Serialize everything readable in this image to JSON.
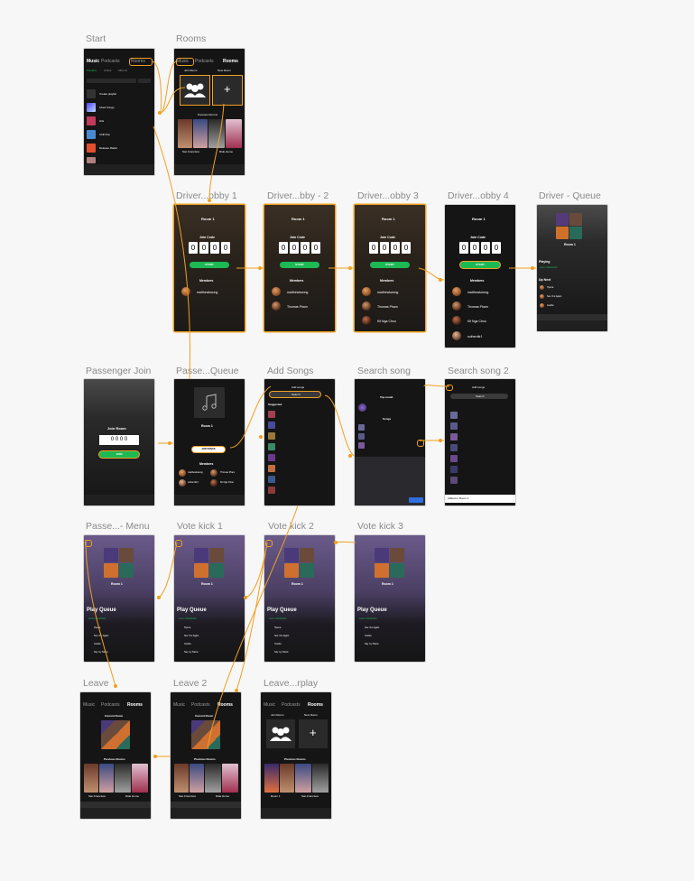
{
  "labels": {
    "start": "Start",
    "rooms": "Rooms",
    "driver_lobby_1": "Driver...obby 1",
    "driver_lobby_2": "Driver...bby - 2",
    "driver_lobby_3": "Driver...obby 3",
    "driver_lobby_4": "Driver...obby 4",
    "driver_queue": "Driver - Queue",
    "passenger_join": "Passenger Join",
    "passenger_queue": "Passe...Queue",
    "add_songs": "Add Songs",
    "search_song": "Search song",
    "search_song_2": "Search song 2",
    "passenger_menu": "Passe...- Menu",
    "vote_kick_1": "Vote kick 1",
    "vote_kick_2": "Vote kick 2",
    "vote_kick_3": "Vote kick 3",
    "leave": "Leave",
    "leave_2": "Leave 2",
    "leave_replay": "Leave...rplay"
  },
  "screens": {
    "top_tabs": {
      "music": "Music",
      "podcasts": "Podcasts",
      "rooms": "Rooms"
    },
    "lib_filters": {
      "playlists": "Playlists",
      "artists": "Artists",
      "albums": "Albums"
    },
    "lib_items": [
      "Create playlist",
      "Liked Songs",
      "Hits",
      "Chill Pop",
      "Release Radar"
    ],
    "join_room": "Join Room",
    "new_room": "New Room",
    "current_room": "Current Room",
    "previous_rooms": "Previous Rooms",
    "room_names": [
      "San Francisco",
      "Ride Home"
    ],
    "room_1": "Room 1",
    "join_code_label": "Join Code",
    "join_code_digits": [
      "0",
      "0",
      "0",
      "0"
    ],
    "start_btn": "START",
    "members_label": "Members",
    "members": [
      "matthewkwong",
      "Thomas Pham",
      "Kit Nga Chou",
      "sutherrtiir1"
    ],
    "playing_label": "Playing",
    "up_next_label": "Up Next",
    "join_code_input": "0 0 0 0",
    "join_btn": "JOIN",
    "add_songs_btn": "ADD SONGS",
    "add_songs_title": "Add songs",
    "search_label": "Search",
    "suggested_label": "Suggested",
    "top_result_label": "Top result",
    "songs_label": "Songs",
    "play_queue": "Play Queue",
    "added_toast": "Added to Room 1",
    "queue_songs": [
      "Lost in Stockholm",
      "Hyena",
      "See You Again",
      "Gooba",
      "Say my Name"
    ]
  },
  "colors": {
    "background": "#f7f7f7",
    "frame": "#151515",
    "accent_wire": "#f0a020",
    "spotify_green": "#1db954",
    "label_grey": "#8a8a8a"
  }
}
